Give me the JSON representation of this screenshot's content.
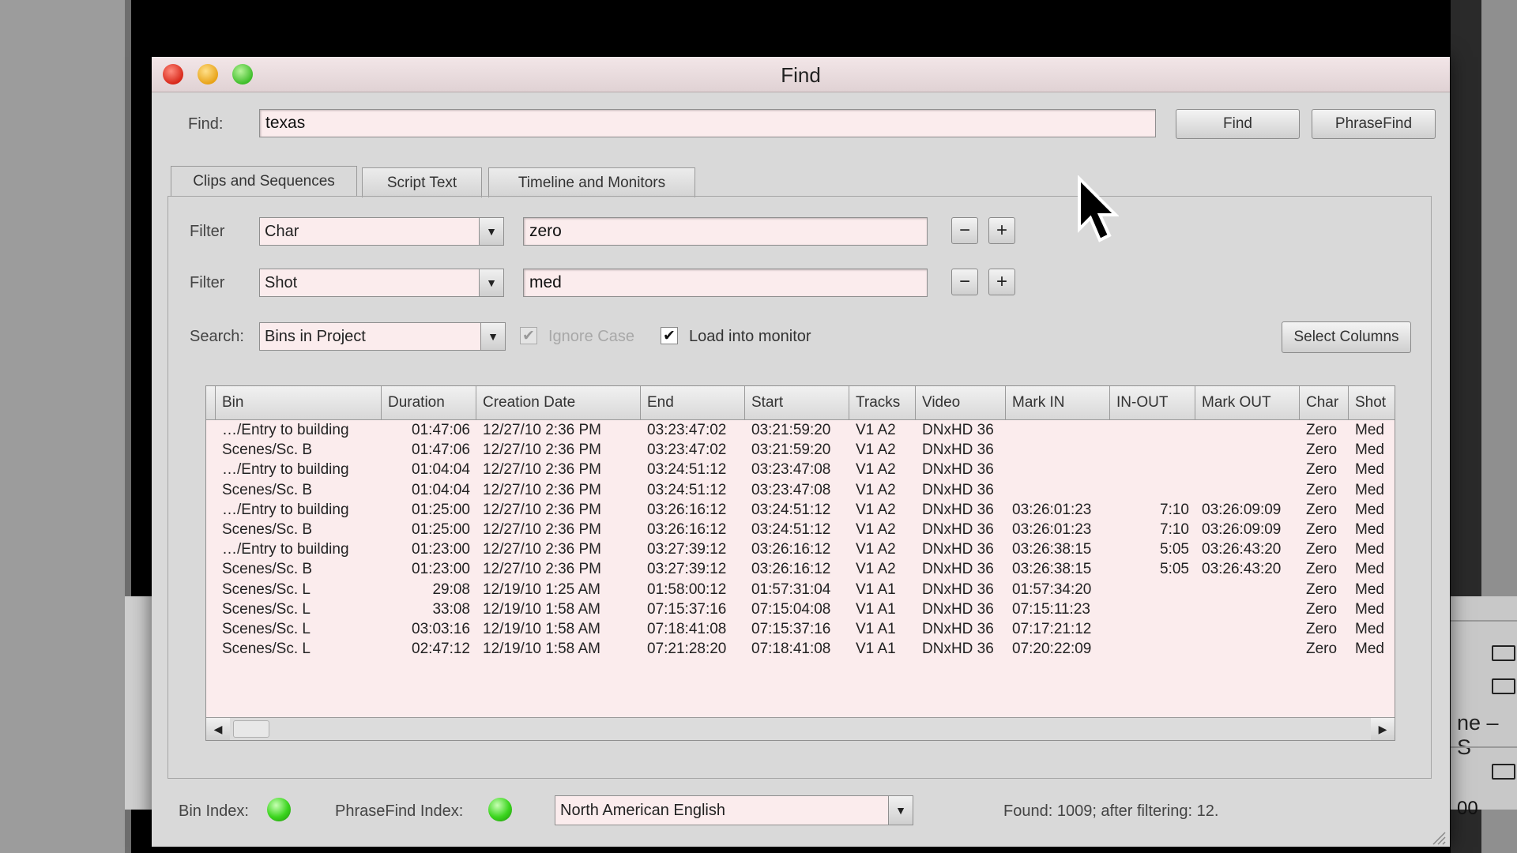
{
  "window": {
    "title": "Find"
  },
  "find": {
    "label": "Find:",
    "value": "texas",
    "find_button": "Find",
    "phrasefind_button": "PhraseFind"
  },
  "tabs": [
    {
      "label": "Clips and Sequences",
      "active": true
    },
    {
      "label": "Script Text",
      "active": false
    },
    {
      "label": "Timeline and Monitors",
      "active": false
    }
  ],
  "filters": [
    {
      "label": "Filter",
      "field": "Char",
      "value": "zero"
    },
    {
      "label": "Filter",
      "field": "Shot",
      "value": "med"
    }
  ],
  "controls": {
    "minus": "−",
    "plus": "+"
  },
  "search": {
    "label": "Search:",
    "value": "Bins in Project",
    "ignore_case_label": "Ignore Case",
    "ignore_case_checked": true,
    "load_monitor_label": "Load into monitor",
    "load_monitor_checked": true,
    "select_columns_button": "Select Columns"
  },
  "table": {
    "columns": [
      "Bin",
      "Duration",
      "Creation Date",
      "End",
      "Start",
      "Tracks",
      "Video",
      "Mark IN",
      "IN-OUT",
      "Mark OUT",
      "Char",
      "Shot"
    ],
    "rows": [
      [
        "…/Entry to building",
        "01:47:06",
        "12/27/10 2:36 PM",
        "03:23:47:02",
        "03:21:59:20",
        "V1 A2",
        "DNxHD 36",
        "",
        "",
        "",
        "Zero",
        "Med"
      ],
      [
        "Scenes/Sc. B",
        "01:47:06",
        "12/27/10 2:36 PM",
        "03:23:47:02",
        "03:21:59:20",
        "V1 A2",
        "DNxHD 36",
        "",
        "",
        "",
        "Zero",
        "Med"
      ],
      [
        "…/Entry to building",
        "01:04:04",
        "12/27/10 2:36 PM",
        "03:24:51:12",
        "03:23:47:08",
        "V1 A2",
        "DNxHD 36",
        "",
        "",
        "",
        "Zero",
        "Med"
      ],
      [
        "Scenes/Sc. B",
        "01:04:04",
        "12/27/10 2:36 PM",
        "03:24:51:12",
        "03:23:47:08",
        "V1 A2",
        "DNxHD 36",
        "",
        "",
        "",
        "Zero",
        "Med"
      ],
      [
        "…/Entry to building",
        "01:25:00",
        "12/27/10 2:36 PM",
        "03:26:16:12",
        "03:24:51:12",
        "V1 A2",
        "DNxHD 36",
        "03:26:01:23",
        "7:10",
        "03:26:09:09",
        "Zero",
        "Med"
      ],
      [
        "Scenes/Sc. B",
        "01:25:00",
        "12/27/10 2:36 PM",
        "03:26:16:12",
        "03:24:51:12",
        "V1 A2",
        "DNxHD 36",
        "03:26:01:23",
        "7:10",
        "03:26:09:09",
        "Zero",
        "Med"
      ],
      [
        "…/Entry to building",
        "01:23:00",
        "12/27/10 2:36 PM",
        "03:27:39:12",
        "03:26:16:12",
        "V1 A2",
        "DNxHD 36",
        "03:26:38:15",
        "5:05",
        "03:26:43:20",
        "Zero",
        "Med"
      ],
      [
        "Scenes/Sc. B",
        "01:23:00",
        "12/27/10 2:36 PM",
        "03:27:39:12",
        "03:26:16:12",
        "V1 A2",
        "DNxHD 36",
        "03:26:38:15",
        "5:05",
        "03:26:43:20",
        "Zero",
        "Med"
      ],
      [
        "Scenes/Sc. L",
        "29:08",
        "12/19/10 1:25 AM",
        "01:58:00:12",
        "01:57:31:04",
        "V1 A1",
        "DNxHD 36",
        "01:57:34:20",
        "",
        "",
        "Zero",
        "Med"
      ],
      [
        "Scenes/Sc. L",
        "33:08",
        "12/19/10 1:58 AM",
        "07:15:37:16",
        "07:15:04:08",
        "V1 A1",
        "DNxHD 36",
        "07:15:11:23",
        "",
        "",
        "Zero",
        "Med"
      ],
      [
        "Scenes/Sc. L",
        "03:03:16",
        "12/19/10 1:58 AM",
        "07:18:41:08",
        "07:15:37:16",
        "V1 A1",
        "DNxHD 36",
        "07:17:21:12",
        "",
        "",
        "Zero",
        "Med"
      ],
      [
        "Scenes/Sc. L",
        "02:47:12",
        "12/19/10 1:58 AM",
        "07:21:28:20",
        "07:18:41:08",
        "V1 A1",
        "DNxHD 36",
        "07:20:22:09",
        "",
        "",
        "Zero",
        "Med"
      ]
    ]
  },
  "footer": {
    "bin_index_label": "Bin Index:",
    "phrasefind_index_label": "PhraseFind Index:",
    "language": "North American English",
    "found_text": "Found: 1009; after filtering: 12."
  },
  "background": {
    "right_text_1": "ne – S",
    "right_text_2": "00"
  },
  "colors": {
    "field_bg": "#fbeced",
    "window_bg": "#d9d9d9",
    "index_led": "#3bd51e"
  }
}
